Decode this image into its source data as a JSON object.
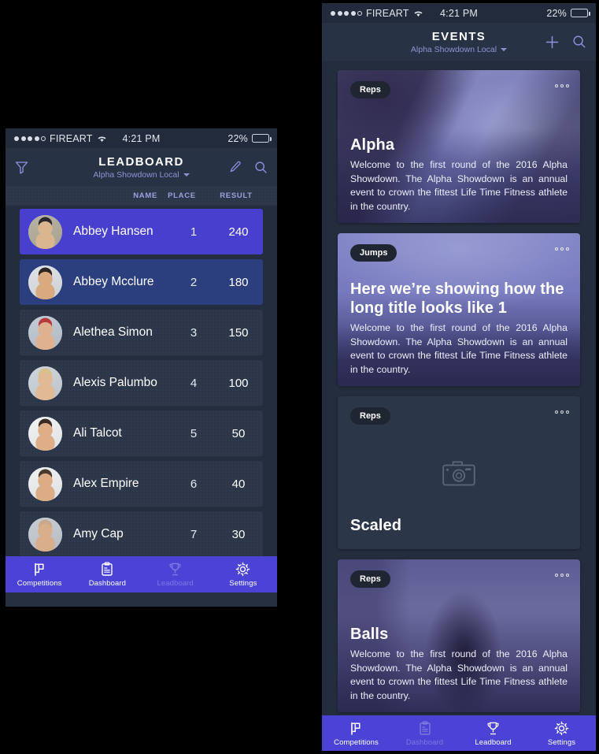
{
  "meta": {
    "background_color": "#000000",
    "accent_purple": "#4a43d6",
    "panel_dark": "#242d3d",
    "nav_bg": "#283245",
    "row_rank1": "#4740cf",
    "row_rank2": "#2b3f7f",
    "row_rest": "#2c3649",
    "subtitle_color": "#8d93d6"
  },
  "status_bar": {
    "signal_dots_filled": 4,
    "signal_dots_total": 5,
    "carrier": "FIREART",
    "wifi_icon": "wifi-icon",
    "time": "4:21 PM",
    "battery_percent": "22%",
    "battery_level": 22
  },
  "phone_left": {
    "nav": {
      "filter_icon": "filter-funnel-icon",
      "title": "LEADBOARD",
      "subtitle": "Alpha Showdown Local",
      "dropdown_icon": "chevron-down-icon",
      "edit_icon": "pencil-icon",
      "search_icon": "search-icon"
    },
    "table": {
      "columns": [
        "NAME",
        "PLACE",
        "RESULT"
      ],
      "rows": [
        {
          "name": "Abbey Hansen",
          "place": "1",
          "result": "240",
          "highlight": "rank1",
          "avatar": "athlete-sunglasses"
        },
        {
          "name": "Abbey Mcclure",
          "place": "2",
          "result": "180",
          "highlight": "rank2",
          "avatar": "athlete-short-hair"
        },
        {
          "name": "Alethea Simon",
          "place": "3",
          "result": "150",
          "highlight": "rest",
          "avatar": "athlete-red-top"
        },
        {
          "name": "Alexis Palumbo",
          "place": "4",
          "result": "100",
          "highlight": "rest",
          "avatar": "athlete-blond"
        },
        {
          "name": "Ali Talcot",
          "place": "5",
          "result": "50",
          "highlight": "rest",
          "avatar": "athlete-smiling"
        },
        {
          "name": "Alex Empire",
          "place": "6",
          "result": "40",
          "highlight": "rest",
          "avatar": "athlete-shirtless"
        },
        {
          "name": "Amy Cap",
          "place": "7",
          "result": "30",
          "highlight": "rest",
          "avatar": "athlete-bald"
        }
      ]
    },
    "tabs": [
      {
        "label": "Competitions",
        "icon": "flag-icon",
        "active": true
      },
      {
        "label": "Dashboard",
        "icon": "clipboard-icon",
        "active": true
      },
      {
        "label": "Leadboard",
        "icon": "trophy-icon",
        "active": false
      },
      {
        "label": "Settings",
        "icon": "gear-icon",
        "active": true
      }
    ]
  },
  "phone_right": {
    "nav": {
      "title": "EVENTS",
      "subtitle": "Alpha Showdown Local",
      "dropdown_icon": "chevron-down-icon",
      "add_icon": "plus-icon",
      "search_icon": "search-icon"
    },
    "cards": [
      {
        "badge": "Reps",
        "title": "Alpha",
        "description": "Welcome to the first round of the 2016 Alpha Showdown. The Alpha Showdown is an annual event to crown the fittest Life Time Fitness athlete in the country.",
        "menu_icon": "more-options-icon",
        "image": "mountain-coast-photo",
        "has_image": true
      },
      {
        "badge": "Jumps",
        "title": "Here we’re showing how the long title looks like 1",
        "description": "Welcome to the first round of the 2016 Alpha Showdown. The Alpha Showdown is an annual event to crown the fittest Life Time Fitness athlete in the country.",
        "menu_icon": "more-options-icon",
        "image": "mountain-sky-photo",
        "has_image": true
      },
      {
        "badge": "Reps",
        "title": "Scaled",
        "description": "",
        "menu_icon": "more-options-icon",
        "image": "camera-placeholder-icon",
        "has_image": false
      },
      {
        "badge": "Reps",
        "title": "Balls",
        "description": "Welcome to the first round of the 2016 Alpha Showdown. The Alpha Showdown is an annual event to crown the fittest Life Time Fitness athlete in the country.",
        "menu_icon": "more-options-icon",
        "image": "man-in-room-photo",
        "has_image": true
      }
    ],
    "tabs": [
      {
        "label": "Competitions",
        "icon": "flag-icon",
        "active": true
      },
      {
        "label": "Dashboard",
        "icon": "clipboard-icon",
        "active": false
      },
      {
        "label": "Leadboard",
        "icon": "trophy-icon",
        "active": true
      },
      {
        "label": "Settings",
        "icon": "gear-icon",
        "active": true
      }
    ]
  }
}
